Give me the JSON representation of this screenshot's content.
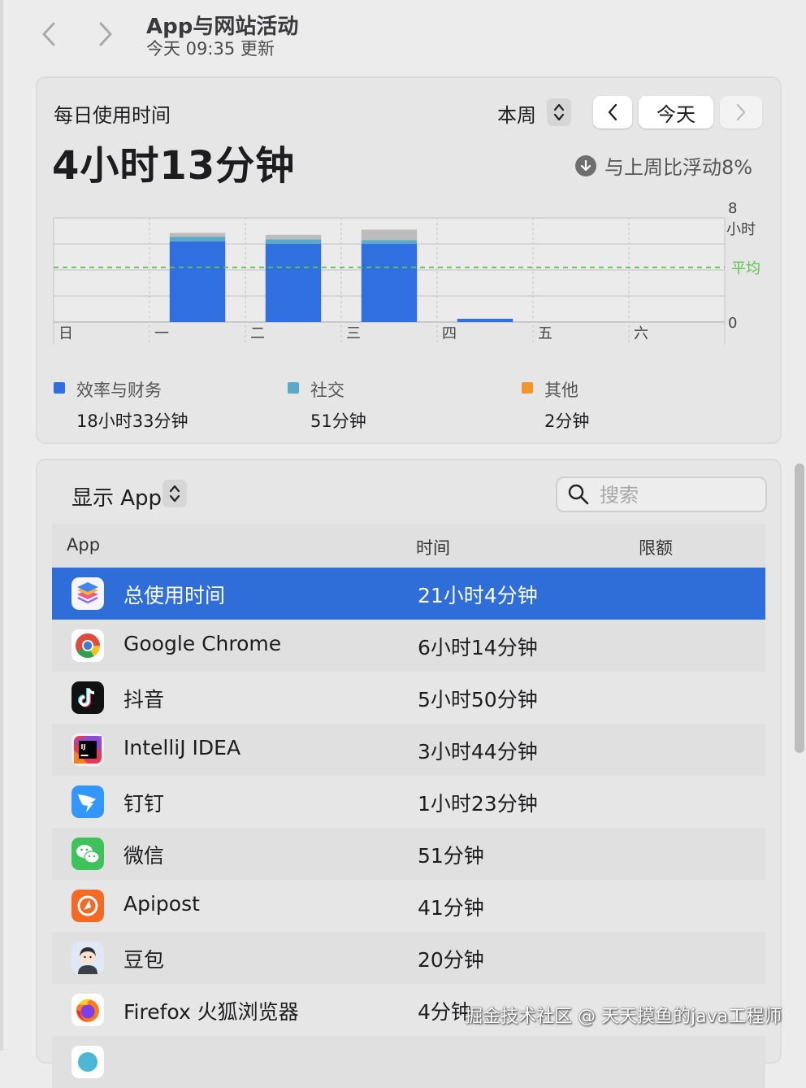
{
  "header": {
    "title": "App与网站活动",
    "subtitle": "今天 09:35 更新"
  },
  "daily": {
    "label": "每日使用时间",
    "total": "4小时13分钟",
    "period": "本周",
    "today_button": "今天",
    "comparison": "与上周比浮动8%"
  },
  "chart_data": {
    "type": "bar",
    "stacked": true,
    "categories": [
      "日",
      "一",
      "二",
      "三",
      "四",
      "五",
      "六"
    ],
    "ylim": [
      0,
      8
    ],
    "y_ticks": [
      "8",
      "0"
    ],
    "y_unit": "小时",
    "average_label": "平均",
    "average": 4.2,
    "grid": true,
    "series": [
      {
        "name": "效率与财务",
        "color": "#2f6fe0",
        "values": [
          0,
          6.2,
          6.0,
          6.0,
          0.25,
          0,
          0
        ]
      },
      {
        "name": "社交",
        "color": "#5aa9c8",
        "values": [
          0,
          0.35,
          0.35,
          0.3,
          0,
          0,
          0
        ]
      },
      {
        "name": "其他",
        "color": "#bcbcbc",
        "values": [
          0,
          0.3,
          0.35,
          0.8,
          0,
          0,
          0
        ]
      }
    ]
  },
  "legend": [
    {
      "name": "效率与财务",
      "value": "18小时33分钟",
      "color": "#2f6fe0"
    },
    {
      "name": "社交",
      "value": "51分钟",
      "color": "#5aa9c8"
    },
    {
      "name": "其他",
      "value": "2分钟",
      "color": "#f0962e"
    }
  ],
  "apps_panel": {
    "show_label": "显示 App",
    "search_placeholder": "搜索",
    "columns": {
      "app": "App",
      "time": "时间",
      "limit": "限额"
    },
    "rows": [
      {
        "name": "总使用时间",
        "time": "21小时4分钟",
        "icon": "stack-icon",
        "selected": true
      },
      {
        "name": "Google Chrome",
        "time": "6小时14分钟",
        "icon": "chrome-icon"
      },
      {
        "name": "抖音",
        "time": "5小时50分钟",
        "icon": "douyin-icon"
      },
      {
        "name": "IntelliJ IDEA",
        "time": "3小时44分钟",
        "icon": "intellij-icon"
      },
      {
        "name": "钉钉",
        "time": "1小时23分钟",
        "icon": "dingtalk-icon"
      },
      {
        "name": "微信",
        "time": "51分钟",
        "icon": "wechat-icon"
      },
      {
        "name": "Apipost",
        "time": "41分钟",
        "icon": "apipost-icon"
      },
      {
        "name": "豆包",
        "time": "20分钟",
        "icon": "doubao-icon"
      },
      {
        "name": "Firefox 火狐浏览器",
        "time": "4分钟",
        "icon": "firefox-icon"
      }
    ]
  },
  "watermark": "掘金技术社区 @ 天天摸鱼的java工程师"
}
